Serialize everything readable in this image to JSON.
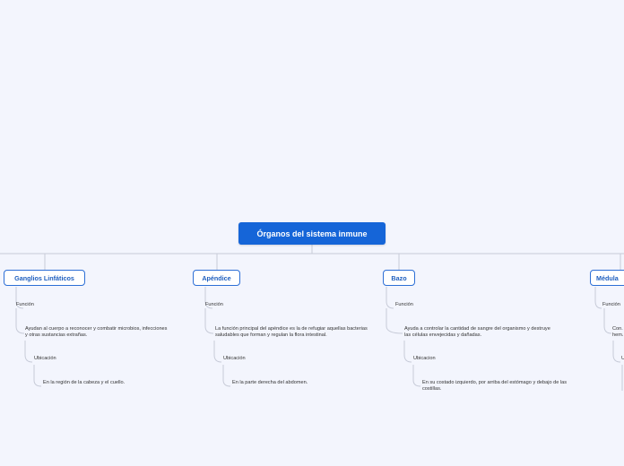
{
  "root": {
    "label": "Órganos del sistema inmune"
  },
  "branches": [
    {
      "title": "Ganglios Linfáticos",
      "funcion_label": "Función",
      "funcion_text": "Ayudan al cuerpo a reconocer y combatir microbios, infecciones y otras sustancias extrañas.",
      "ubicacion_label": "Ubicación",
      "ubicacion_text": "En la región de la cabeza y el cuello."
    },
    {
      "title": "Apéndice",
      "funcion_label": "Función",
      "funcion_text": "La función principal del apéndice es la de refugiar aquellas bacterias saludables que forman y regulan la flora intestinal.",
      "ubicacion_label": "Ubicación",
      "ubicacion_text": "En la parte derecha del abdomen."
    },
    {
      "title": "Bazo",
      "funcion_label": "Función",
      "funcion_text": "Ayuda a controlar la cantidad de sangre del organismo y destruye las células envejecidas y dañadas.",
      "ubicacion_label": "Ubicacion",
      "ubicacion_text": "En su costado izquierdo, por arriba del estómago y debajo de las costillas."
    },
    {
      "title": "Médula",
      "funcion_label": "Función",
      "funcion_text": "Con... hem...",
      "ubicacion_label": "U"
    }
  ],
  "colors": {
    "background": "#f3f5fd",
    "root_fill": "#1565d8",
    "branch_border": "#2d6fd6",
    "line": "#c5c9d6"
  }
}
